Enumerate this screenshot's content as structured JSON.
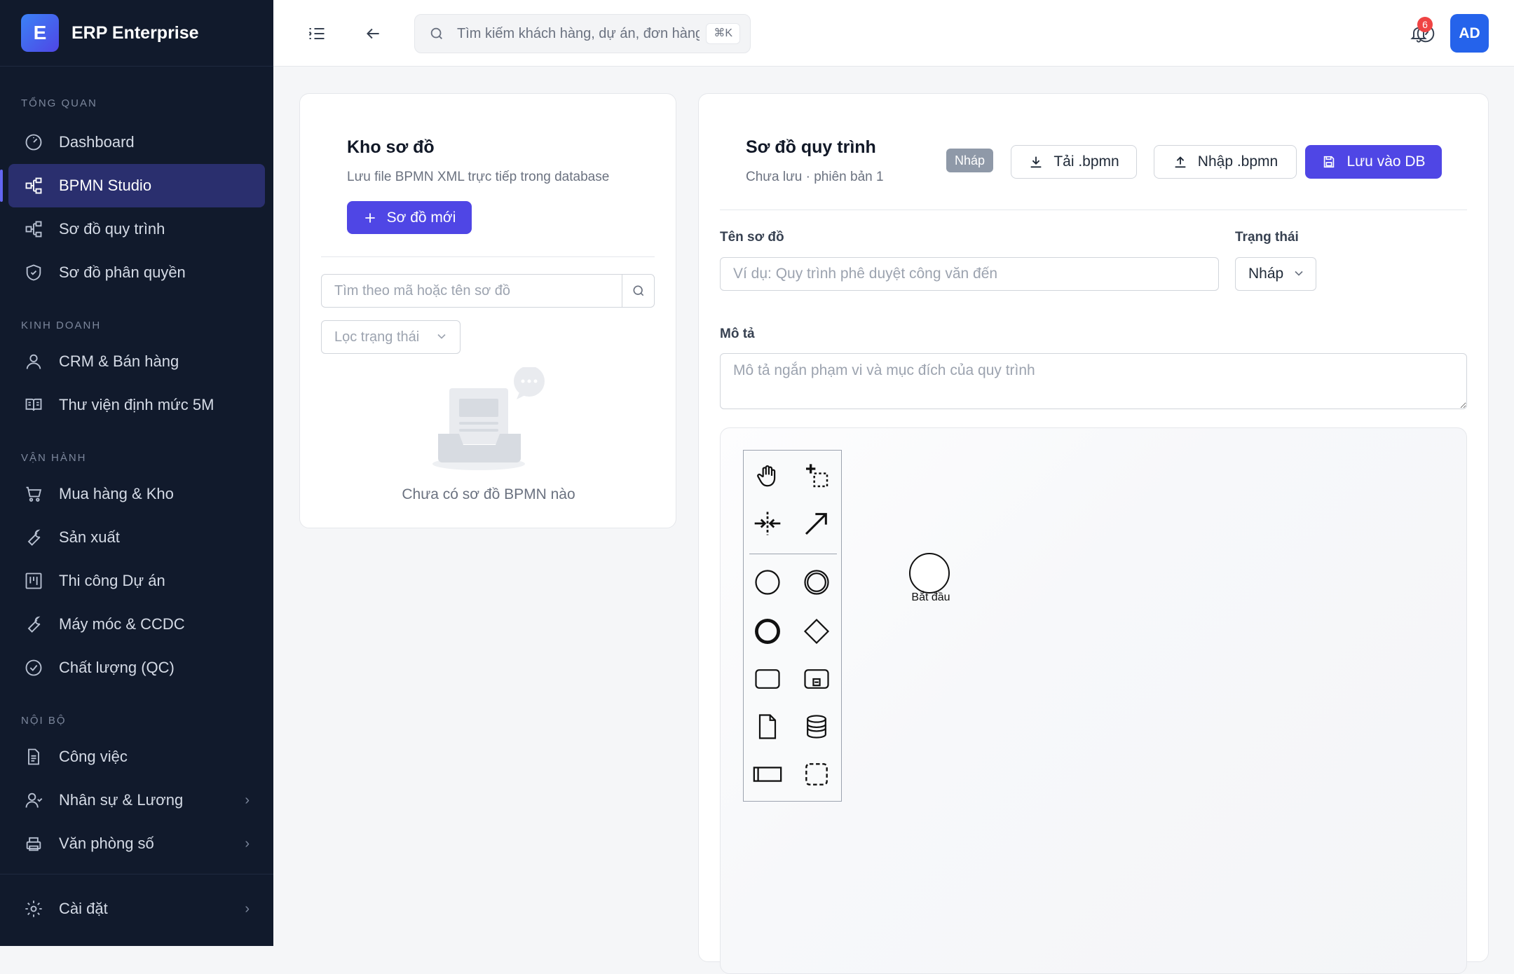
{
  "app": {
    "brand_letter": "E",
    "brand_name": "ERP Enterprise"
  },
  "sidebar": {
    "sections": [
      {
        "title": "TỔNG QUAN"
      },
      {
        "title": "KINH DOANH"
      },
      {
        "title": "VẬN HÀNH"
      },
      {
        "title": "NỘI BỘ"
      }
    ],
    "items": [
      {
        "label": "Dashboard",
        "icon": "dashboard-gauge-icon"
      },
      {
        "label": "BPMN Studio",
        "icon": "diagram-nodes-icon",
        "active": true
      },
      {
        "label": "Sơ đồ quy trình",
        "icon": "diagram-nodes-icon"
      },
      {
        "label": "Sơ đồ phân quyền",
        "icon": "shield-icon"
      },
      {
        "label": "CRM & Bán hàng",
        "icon": "user-icon"
      },
      {
        "label": "Thư viện định mức 5M",
        "icon": "book-open-icon"
      },
      {
        "label": "Mua hàng & Kho",
        "icon": "cart-icon"
      },
      {
        "label": "Sản xuất",
        "icon": "wrench-icon"
      },
      {
        "label": "Thi công Dự án",
        "icon": "kanban-icon"
      },
      {
        "label": "Máy móc & CCDC",
        "icon": "wrench-icon"
      },
      {
        "label": "Chất lượng (QC)",
        "icon": "check-circle-icon"
      },
      {
        "label": "Công việc",
        "icon": "document-icon"
      },
      {
        "label": "Nhân sự & Lương",
        "icon": "users-icon"
      },
      {
        "label": "Văn phòng số",
        "icon": "printer-icon"
      }
    ],
    "settings_label": "Cài đặt",
    "accent": "#6366f1"
  },
  "header": {
    "search_placeholder": "Tìm kiếm khách hàng, dự án, đơn hàng...",
    "shortcut": "⌘K",
    "notifications_count": "6",
    "avatar_initials": "AD"
  },
  "repo": {
    "title": "Kho sơ đồ",
    "subtitle": "Lưu file BPMN XML trực tiếp trong database",
    "new_button": "Sơ đồ mới",
    "search_placeholder": "Tìm theo mã hoặc tên sơ đồ",
    "filter_placeholder": "Lọc trạng thái",
    "empty_text": "Chưa có sơ đồ BPMN nào"
  },
  "editor": {
    "title": "Sơ đồ quy trình",
    "subtitle": "Chưa lưu · phiên bản 1",
    "status_chip": "Nháp",
    "download_button": "Tải .bpmn",
    "import_button": "Nhập .bpmn",
    "save_button": "Lưu vào DB",
    "name_label": "Tên sơ đồ",
    "name_placeholder": "Ví dụ: Quy trình phê duyệt công văn đến",
    "status_label": "Trạng thái",
    "status_value": "Nháp",
    "desc_label": "Mô tả",
    "desc_placeholder": "Mô tả ngắn phạm vi và mục đích của quy trình",
    "start_event_label": "Bắt đầu"
  },
  "colors": {
    "primary": "#4f46e5",
    "sidebar_bg": "#111a2c",
    "avatar": "#2563eb",
    "badge": "#ef4444"
  }
}
